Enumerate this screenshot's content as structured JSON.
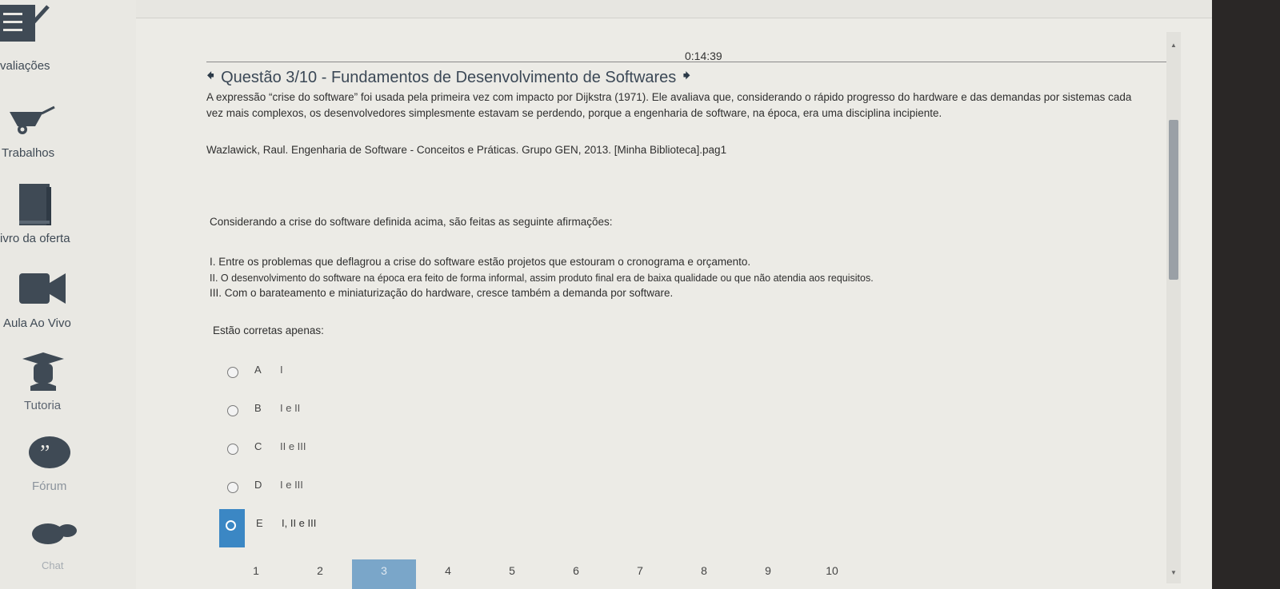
{
  "sidebar": {
    "items": [
      {
        "label": "valiações",
        "icon": "checklist-icon"
      },
      {
        "label": "Trabalhos",
        "icon": "wheelbarrow-icon"
      },
      {
        "label": "ivro da oferta",
        "icon": "book-icon"
      },
      {
        "label": "Aula Ao Vivo",
        "icon": "video-camera-icon"
      },
      {
        "label": "Tutoria",
        "icon": "graduation-cap-icon"
      },
      {
        "label": "Fórum",
        "icon": "quote-bubble-icon"
      },
      {
        "label": "Chat",
        "icon": "chat-bubble-icon"
      }
    ]
  },
  "exam": {
    "timer": "0:14:39",
    "title": "Questão 3/10 - Fundamentos de Desenvolvimento de Softwares",
    "intro": "A expressão “crise do software” foi usada pela primeira vez com impacto por Dijkstra (1971). Ele avaliava que, considerando o rápido progresso do hardware e das demandas por sistemas cada vez mais complexos, os desenvolvedores simplesmente estavam se perdendo, porque a engenharia de software, na época, era uma disciplina incipiente.",
    "reference": "Wazlawick, Raul. Engenharia de Software - Conceitos e Práticas. Grupo GEN, 2013. [Minha Biblioteca].pag1",
    "prompt": "Considerando a crise do software definida acima, são feitas as seguinte afirmações:",
    "statements": [
      "I. Entre os problemas que deflagrou a crise do software estão projetos que estouram o cronograma e orçamento.",
      "II. O desenvolvimento do software na época era feito de forma informal, assim  produto final era de baixa qualidade ou que não atendia aos requisitos.",
      "III. Com o barateamento e miniaturização do hardware, cresce também a demanda por software."
    ],
    "question": "Estão corretas apenas:",
    "options": [
      {
        "letter": "A",
        "text": "I"
      },
      {
        "letter": "B",
        "text": "I e II"
      },
      {
        "letter": "C",
        "text": "II e III"
      },
      {
        "letter": "D",
        "text": "I e III"
      },
      {
        "letter": "E",
        "text": "I, II e III"
      }
    ],
    "selected_option": "E"
  },
  "pagination": {
    "pages": [
      "1",
      "2",
      "3",
      "4",
      "5",
      "6",
      "7",
      "8",
      "9",
      "10"
    ],
    "current": "3"
  },
  "colors": {
    "accent": "#3b87c4",
    "sidebar_text": "#3f4a55",
    "active_page": "#7aa6c9"
  }
}
